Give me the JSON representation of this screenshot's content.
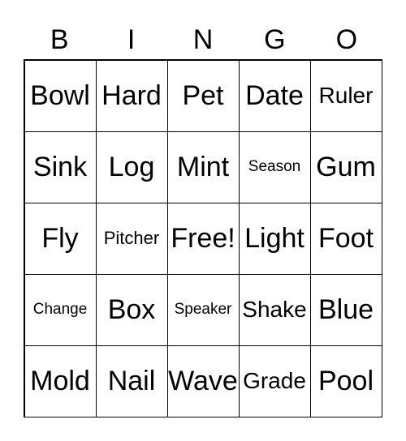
{
  "header": [
    "B",
    "I",
    "N",
    "G",
    "O"
  ],
  "cells": [
    [
      "Bowl",
      "Hard",
      "Pet",
      "Date",
      "Ruler"
    ],
    [
      "Sink",
      "Log",
      "Mint",
      "Season",
      "Gum"
    ],
    [
      "Fly",
      "Pitcher",
      "Free!",
      "Light",
      "Foot"
    ],
    [
      "Change",
      "Box",
      "Speaker",
      "Shake",
      "Blue"
    ],
    [
      "Mold",
      "Nail",
      "Wave",
      "Grade",
      "Pool"
    ]
  ]
}
